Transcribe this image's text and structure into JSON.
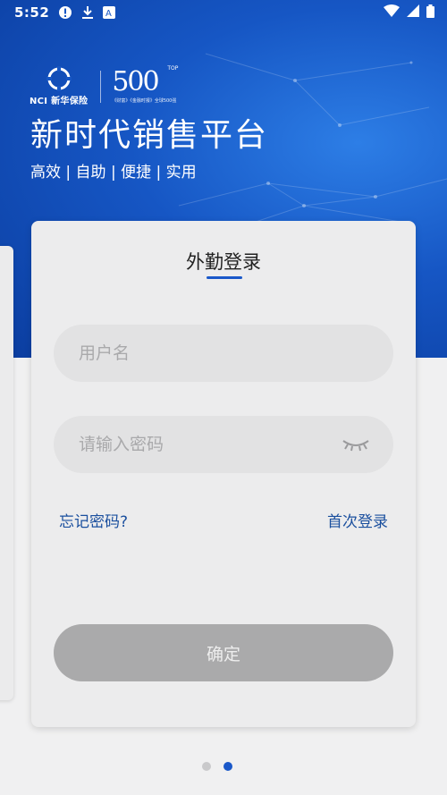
{
  "status_bar": {
    "time": "5:52",
    "icons": [
      "alert-icon",
      "download-icon",
      "app-notification-icon",
      "wifi-icon",
      "signal-icon",
      "battery-icon"
    ]
  },
  "brand": {
    "logo_text": "NCI 新华保险",
    "badge_number": "500",
    "badge_top": "TOP",
    "badge_caption": "《财富》《金融时报》全球500强"
  },
  "header": {
    "title": "新时代销售平台",
    "subtitle": "高效 | 自助 | 便捷 | 实用"
  },
  "login_card": {
    "tab_title": "外勤登录",
    "username_placeholder": "用户名",
    "password_placeholder": "请输入密码",
    "forgot_password": "忘记密码?",
    "first_login": "首次登录",
    "confirm_label": "确定"
  },
  "pager": {
    "count": 2,
    "active_index": 1
  },
  "colors": {
    "brand_blue": "#1656c4",
    "link_blue": "#1a4f9e",
    "button_disabled": "#aaaaab",
    "background": "#f0f0f1"
  }
}
